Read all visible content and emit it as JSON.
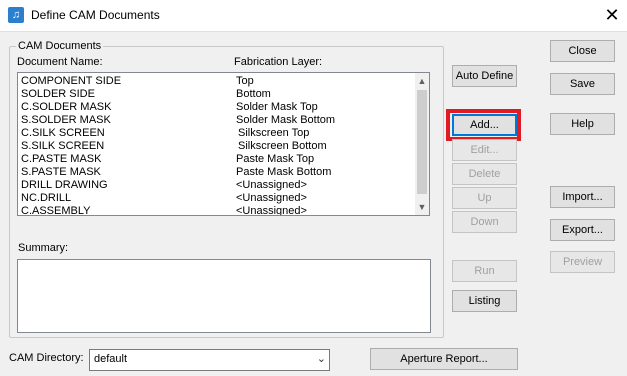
{
  "window": {
    "title": "Define CAM Documents",
    "close_glyph": "✕",
    "icon": "document-music-icon"
  },
  "group": {
    "title": "CAM Documents"
  },
  "list": {
    "col_name": "Document Name:",
    "col_layer": "Fabrication Layer:",
    "rows": [
      {
        "name": "COMPONENT SIDE",
        "layer": "Top"
      },
      {
        "name": "SOLDER SIDE",
        "layer": "Bottom"
      },
      {
        "name": "C.SOLDER MASK",
        "layer": "Solder Mask Top"
      },
      {
        "name": "S.SOLDER MASK",
        "layer": "Solder Mask Bottom"
      },
      {
        "name": "C.SILK SCREEN",
        "layer": "Silkscreen Top"
      },
      {
        "name": "S.SILK SCREEN",
        "layer": "Silkscreen Bottom"
      },
      {
        "name": "C.PASTE MASK",
        "layer": "Paste Mask Top"
      },
      {
        "name": "S.PASTE MASK",
        "layer": "Paste Mask Bottom"
      },
      {
        "name": "DRILL DRAWING",
        "layer": "<Unassigned>"
      },
      {
        "name": "NC.DRILL",
        "layer": "<Unassigned>"
      },
      {
        "name": "C.ASSEMBLY",
        "layer": "<Unassigned>"
      }
    ]
  },
  "summary": {
    "label": "Summary:"
  },
  "buttons": {
    "auto_define": "Auto Define",
    "add": "Add...",
    "edit": "Edit...",
    "delete": "Delete",
    "up": "Up",
    "down": "Down",
    "run": "Run",
    "listing": "Listing",
    "close": "Close",
    "save": "Save",
    "help": "Help",
    "import": "Import...",
    "export": "Export...",
    "preview": "Preview",
    "aperture_report": "Aperture Report..."
  },
  "cam_directory": {
    "label": "CAM Directory:",
    "value": "default"
  },
  "colors": {
    "highlight": "#e11b22",
    "focus": "#0078d7"
  }
}
